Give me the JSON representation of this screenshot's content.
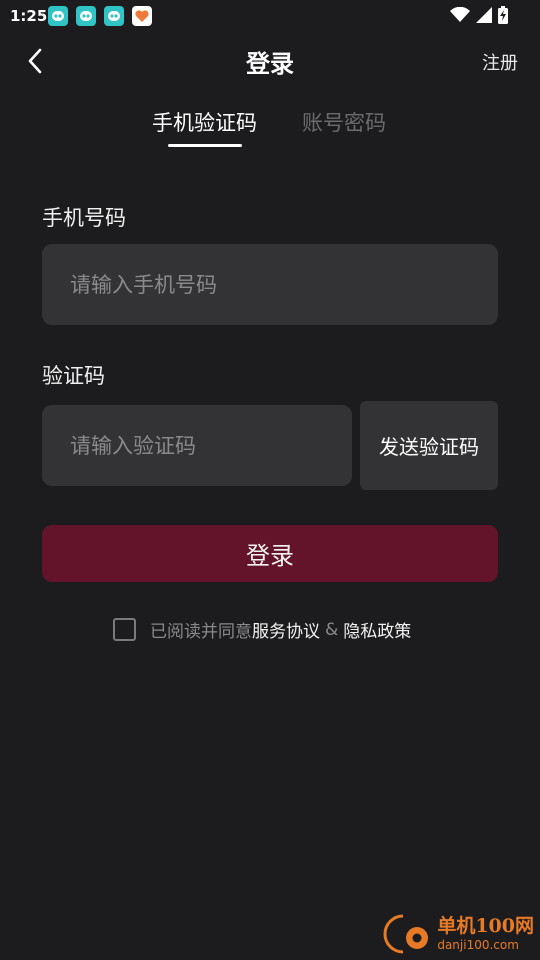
{
  "status_bar": {
    "time": "1:25",
    "app_icons": [
      "app-notification-icon",
      "app-notification-icon",
      "app-notification-icon",
      "heart-app-icon"
    ],
    "system_icons": [
      "wifi-icon",
      "signal-icon",
      "battery-icon"
    ]
  },
  "header": {
    "title": "登录",
    "register_label": "注册"
  },
  "tabs": [
    {
      "label": "手机验证码",
      "active": true
    },
    {
      "label": "账号密码",
      "active": false
    }
  ],
  "form": {
    "phone_label": "手机号码",
    "phone_placeholder": "请输入手机号码",
    "code_label": "验证码",
    "code_placeholder": "请输入验证码",
    "send_code_label": "发送验证码",
    "login_label": "登录"
  },
  "agreement": {
    "prefix": "已阅读并同意",
    "service_link": "服务协议",
    "amp": "&",
    "privacy_link": "隐私政策",
    "checked": false
  },
  "watermark": {
    "name": "单机100网",
    "url": "danji100.com"
  },
  "colors": {
    "background": "#1c1c1e",
    "input_bg": "#333335",
    "login_button": "#63142a",
    "watermark": "#e67a26"
  }
}
